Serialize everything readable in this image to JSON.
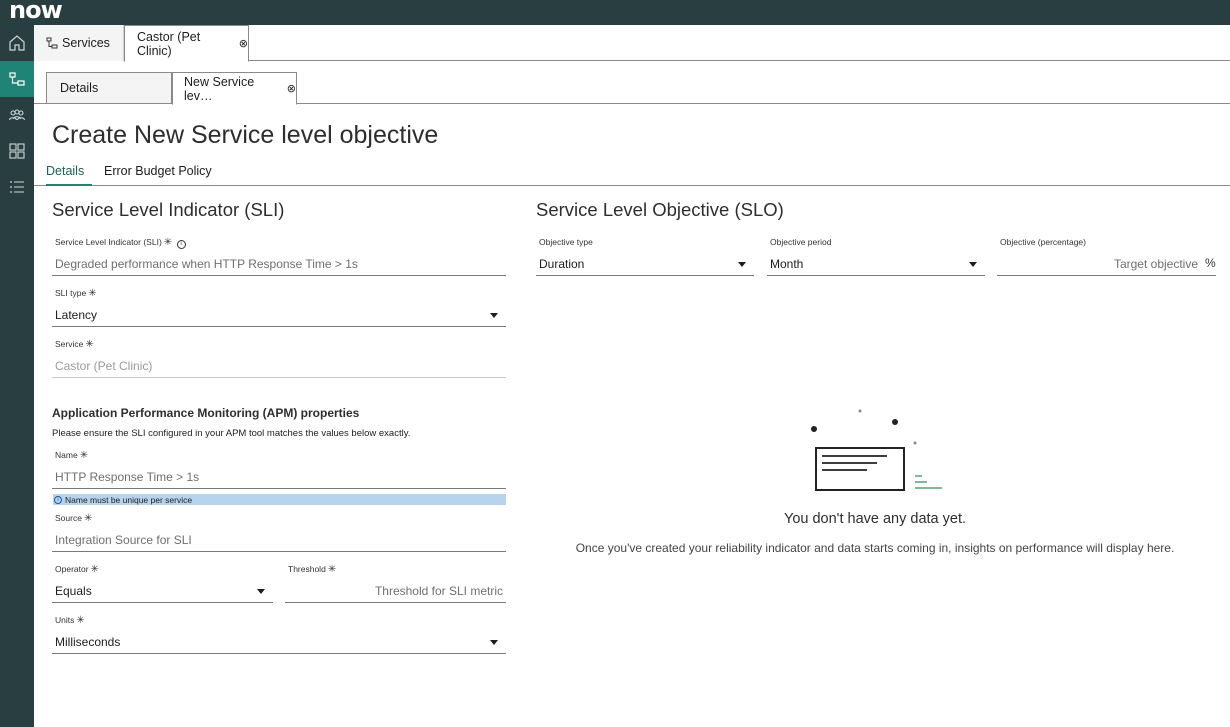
{
  "app": {
    "logo_text": "now"
  },
  "top_tabs": [
    {
      "label": "Services",
      "icon": "hierarchy-icon"
    },
    {
      "label": "Castor (Pet Clinic)",
      "closable": true
    }
  ],
  "sub_tabs": [
    {
      "label": "Details"
    },
    {
      "label": "New Service lev…",
      "closable": true
    }
  ],
  "page": {
    "title": "Create New Service level objective"
  },
  "form_tabs": [
    {
      "label": "Details",
      "active": true
    },
    {
      "label": "Error Budget Policy",
      "active": false
    }
  ],
  "sli": {
    "section_title": "Service Level Indicator (SLI)",
    "indicator": {
      "label": "Service Level Indicator (SLI)",
      "placeholder": "Degraded performance when HTTP Response Time > 1s"
    },
    "sli_type": {
      "label": "SLI type",
      "value": "Latency"
    },
    "service": {
      "label": "Service",
      "value": "Castor (Pet Clinic)"
    }
  },
  "apm": {
    "title": "Application Performance Monitoring (APM) properties",
    "description": "Please ensure the SLI configured in your APM tool matches the values below exactly.",
    "name": {
      "label": "Name",
      "placeholder": "HTTP Response Time > 1s",
      "hint": "Name must be unique per service"
    },
    "source": {
      "label": "Source",
      "placeholder": "Integration Source for SLI"
    },
    "operator": {
      "label": "Operator",
      "value": "Equals"
    },
    "threshold": {
      "label": "Threshold",
      "placeholder": "Threshold for SLI metric"
    },
    "units": {
      "label": "Units",
      "value": "Milliseconds"
    }
  },
  "slo": {
    "section_title": "Service Level Objective (SLO)",
    "objective_type": {
      "label": "Objective type",
      "value": "Duration"
    },
    "objective_period": {
      "label": "Objective period",
      "value": "Month"
    },
    "objective_pct": {
      "label": "Objective (percentage)",
      "placeholder": "Target objective",
      "unit": "%"
    }
  },
  "empty_state": {
    "title": "You don't have any data yet.",
    "description": "Once you've created your reliability indicator and data starts coming in, insights on performance will display here."
  },
  "colors": {
    "rail_bg": "#293e40",
    "accent": "#1f8476",
    "info_bg": "#b7d4ec"
  }
}
